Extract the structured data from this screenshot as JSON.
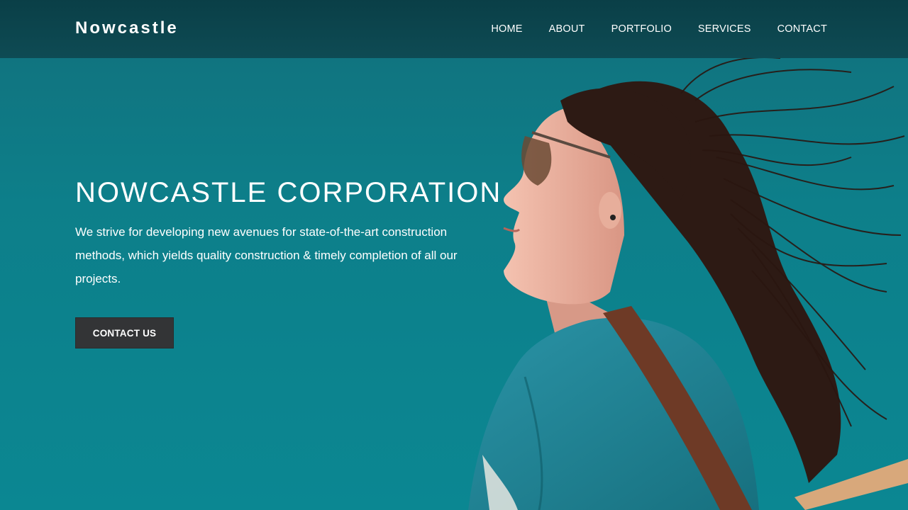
{
  "header": {
    "brand": "Nowcastle",
    "nav": [
      {
        "label": "HOME"
      },
      {
        "label": "ABOUT"
      },
      {
        "label": "PORTFOLIO"
      },
      {
        "label": "SERVICES"
      },
      {
        "label": "CONTACT"
      }
    ]
  },
  "hero": {
    "title": "NOWCASTLE CORPORATION",
    "description": "We strive for developing new avenues for state-of-the-art construction methods, which yields quality construction & timely completion of all our projects.",
    "cta_label": "CONTACT US",
    "image": "woman-in-sunglasses-photo"
  },
  "colors": {
    "navbar": "#0b424b",
    "hero_background": "#0e7e89",
    "cta_background": "#333436",
    "text": "#ffffff"
  }
}
